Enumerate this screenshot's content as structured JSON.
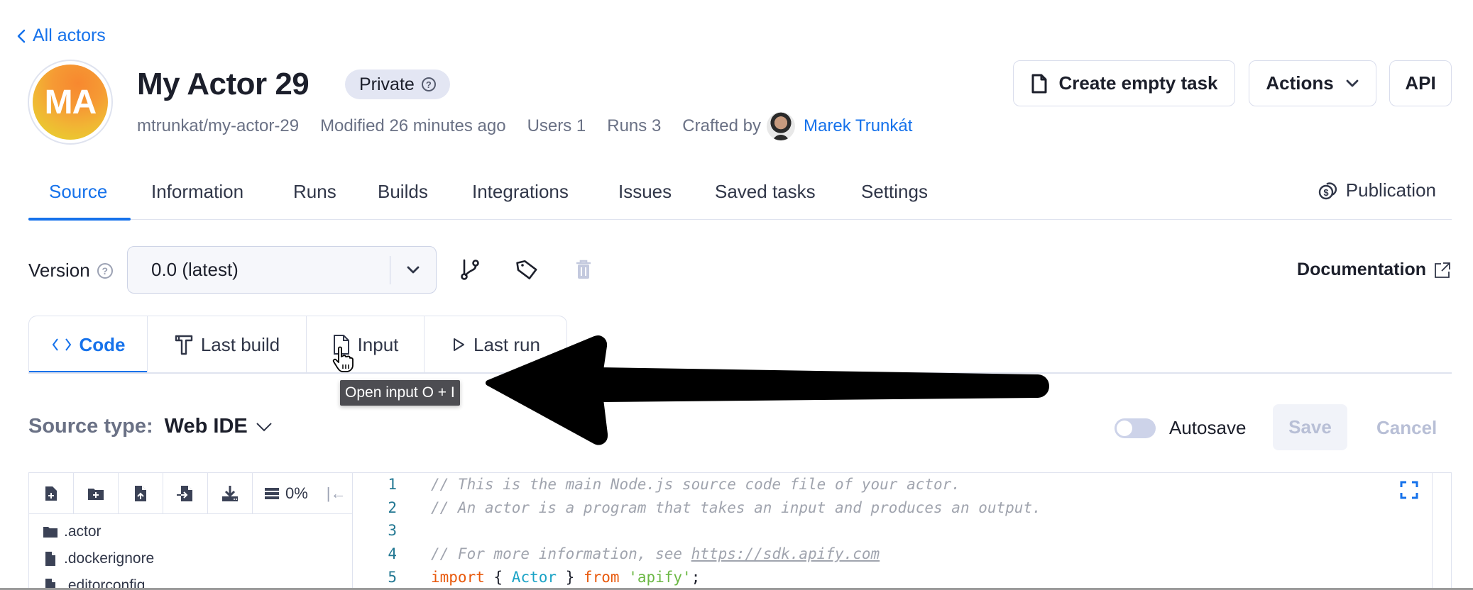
{
  "nav": {
    "back_label": "All actors"
  },
  "actor": {
    "avatar_initials": "MA",
    "title": "My Actor 29",
    "visibility_badge": "Private",
    "slug": "mtrunkat/my-actor-29",
    "modified": "Modified 26 minutes ago",
    "users": "Users 1",
    "runs": "Runs 3",
    "crafted_by_label": "Crafted by",
    "author": "Marek Trunkát"
  },
  "header_buttons": {
    "create_task": "Create empty task",
    "actions": "Actions",
    "api": "API"
  },
  "tabs": [
    {
      "label": "Source",
      "active": true
    },
    {
      "label": "Information"
    },
    {
      "label": "Runs"
    },
    {
      "label": "Builds"
    },
    {
      "label": "Integrations"
    },
    {
      "label": "Issues"
    },
    {
      "label": "Saved tasks"
    },
    {
      "label": "Settings"
    }
  ],
  "publication_label": "Publication",
  "version": {
    "label": "Version",
    "selected": "0.0 (latest)"
  },
  "documentation_label": "Documentation",
  "code_tabs": [
    {
      "label": "Code",
      "icon": "code-brackets-icon",
      "active": true
    },
    {
      "label": "Last build",
      "icon": "hammer-icon"
    },
    {
      "label": "Input",
      "icon": "file-icon"
    },
    {
      "label": "Last run",
      "icon": "play-icon"
    }
  ],
  "tooltip": "Open input O + I",
  "source_type": {
    "label": "Source type:",
    "value": "Web IDE"
  },
  "autosave": {
    "label": "Autosave",
    "enabled": false
  },
  "save_label": "Save",
  "cancel_label": "Cancel",
  "file_panel": {
    "progress": "0%",
    "files": [
      {
        "name": ".actor",
        "type": "folder"
      },
      {
        "name": ".dockerignore",
        "type": "file"
      },
      {
        "name": ".editorconfig",
        "type": "file"
      }
    ]
  },
  "editor": {
    "lines": [
      {
        "n": "1",
        "comment": "// This is the main Node.js source code file of your actor."
      },
      {
        "n": "2",
        "comment": "// An actor is a program that takes an input and produces an output."
      },
      {
        "n": "3",
        "comment": ""
      },
      {
        "n": "4",
        "comment": "// For more information, see ",
        "url": "https://sdk.apify.com"
      },
      {
        "n": "5",
        "kw1": "import",
        "p1": " { ",
        "id": "Actor",
        "p2": " } ",
        "kw2": "from",
        "sp": " ",
        "str": "'apify'",
        "p3": ";"
      }
    ]
  }
}
